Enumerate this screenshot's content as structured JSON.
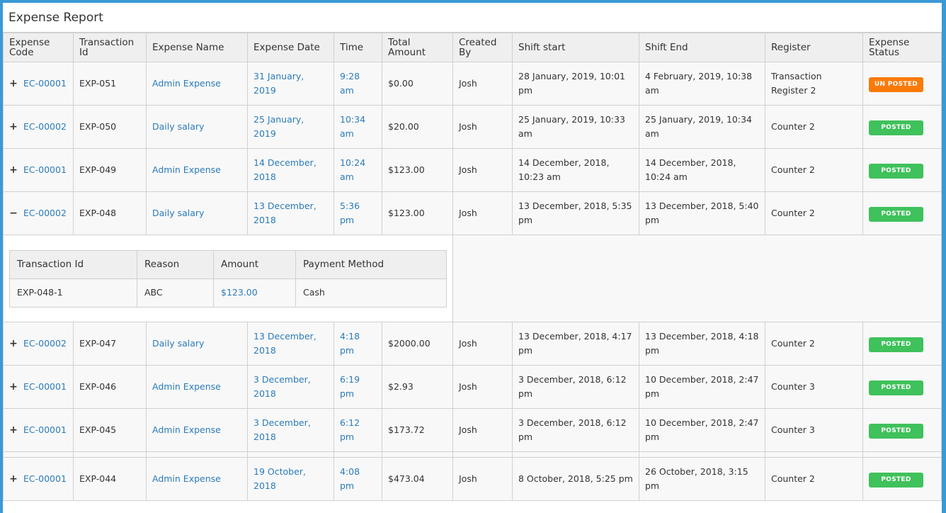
{
  "title": "Expense Report",
  "columns": [
    "Expense Code",
    "Transaction Id",
    "Expense Name",
    "Expense Date",
    "Time",
    "Total Amount",
    "Created By",
    "Shift start",
    "Shift End",
    "Register",
    "Expense Status"
  ],
  "colors": {
    "posted": "#3fc15b",
    "unposted": "#f97a09",
    "link": "#2b7bb9",
    "frame": "#3a9ad6"
  },
  "rows": [
    {
      "toggle": "+",
      "code": "EC-00001",
      "txn": "EXP-051",
      "name": "Admin Expense",
      "date": "31 January, 2019",
      "time": "9:28 am",
      "amount": "$0.00",
      "by": "Josh",
      "shift_start": "28 January, 2019, 10:01 pm",
      "shift_end": "4 February, 2019, 10:38 am",
      "register": "Transaction Register 2",
      "status": "UN POSTED",
      "status_kind": "unposted"
    },
    {
      "toggle": "+",
      "code": "EC-00002",
      "txn": "EXP-050",
      "name": "Daily salary",
      "date": "25 January, 2019",
      "time": "10:34 am",
      "amount": "$20.00",
      "by": "Josh",
      "shift_start": "25 January, 2019, 10:33 am",
      "shift_end": "25 January, 2019, 10:34 am",
      "register": "Counter 2",
      "status": "POSTED",
      "status_kind": "posted"
    },
    {
      "toggle": "+",
      "code": "EC-00001",
      "txn": "EXP-049",
      "name": "Admin Expense",
      "date": "14 December, 2018",
      "time": "10:24 am",
      "amount": "$123.00",
      "by": "Josh",
      "shift_start": "14 December, 2018, 10:23 am",
      "shift_end": "14 December, 2018, 10:24 am",
      "register": "Counter 2",
      "status": "POSTED",
      "status_kind": "posted"
    },
    {
      "toggle": "−",
      "code": "EC-00002",
      "txn": "EXP-048",
      "name": "Daily salary",
      "date": "13 December, 2018",
      "time": "5:36 pm",
      "amount": "$123.00",
      "by": "Josh",
      "shift_start": "13 December, 2018, 5:35 pm",
      "shift_end": "13 December, 2018, 5:40 pm",
      "register": "Counter 2",
      "status": "POSTED",
      "status_kind": "posted",
      "details": {
        "columns": [
          "Transaction Id",
          "Reason",
          "Amount",
          "Payment Method"
        ],
        "rows": [
          {
            "txn": "EXP-048-1",
            "reason": "ABC",
            "amount": "$123.00",
            "method": "Cash"
          }
        ]
      }
    },
    {
      "toggle": "+",
      "code": "EC-00002",
      "txn": "EXP-047",
      "name": "Daily salary",
      "date": "13 December, 2018",
      "time": "4:18 pm",
      "amount": "$2000.00",
      "by": "Josh",
      "shift_start": "13 December, 2018, 4:17 pm",
      "shift_end": "13 December, 2018, 4:18 pm",
      "register": "Counter 2",
      "status": "POSTED",
      "status_kind": "posted"
    },
    {
      "toggle": "+",
      "code": "EC-00001",
      "txn": "EXP-046",
      "name": "Admin Expense",
      "date": "3 December, 2018",
      "time": "6:19 pm",
      "amount": "$2.93",
      "by": "Josh",
      "shift_start": "3 December, 2018, 6:12 pm",
      "shift_end": "10 December, 2018, 2:47 pm",
      "register": "Counter 3",
      "status": "POSTED",
      "status_kind": "posted"
    },
    {
      "toggle": "+",
      "code": "EC-00001",
      "txn": "EXP-045",
      "name": "Admin Expense",
      "date": "3 December, 2018",
      "time": "6:12 pm",
      "amount": "$173.72",
      "by": "Josh",
      "shift_start": "3 December, 2018, 6:12 pm",
      "shift_end": "10 December, 2018, 2:47 pm",
      "register": "Counter 3",
      "status": "POSTED",
      "status_kind": "posted"
    },
    {
      "toggle": "+",
      "code": "EC-00001",
      "txn": "EXP-044",
      "name": "Admin Expense",
      "date": "19 October, 2018",
      "time": "4:08 pm",
      "amount": "$473.04",
      "by": "Josh",
      "shift_start": "8 October, 2018, 5:25 pm",
      "shift_end": "26 October, 2018, 3:15 pm",
      "register": "Counter 2",
      "status": "POSTED",
      "status_kind": "posted"
    }
  ]
}
